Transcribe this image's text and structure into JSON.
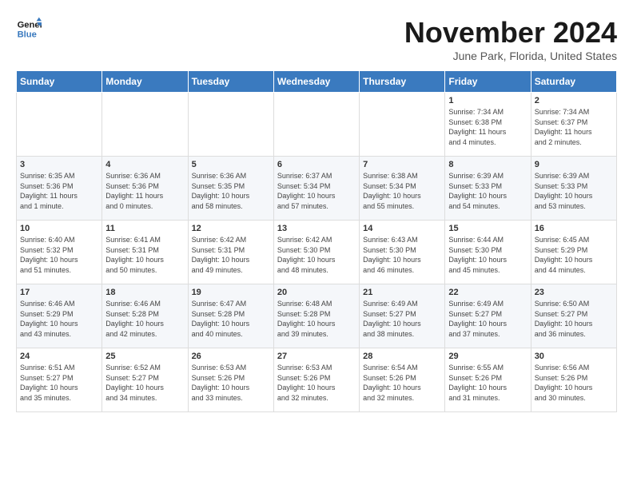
{
  "header": {
    "logo_line1": "General",
    "logo_line2": "Blue",
    "month": "November 2024",
    "location": "June Park, Florida, United States"
  },
  "weekdays": [
    "Sunday",
    "Monday",
    "Tuesday",
    "Wednesday",
    "Thursday",
    "Friday",
    "Saturday"
  ],
  "weeks": [
    [
      {
        "day": "",
        "info": ""
      },
      {
        "day": "",
        "info": ""
      },
      {
        "day": "",
        "info": ""
      },
      {
        "day": "",
        "info": ""
      },
      {
        "day": "",
        "info": ""
      },
      {
        "day": "1",
        "info": "Sunrise: 7:34 AM\nSunset: 6:38 PM\nDaylight: 11 hours\nand 4 minutes."
      },
      {
        "day": "2",
        "info": "Sunrise: 7:34 AM\nSunset: 6:37 PM\nDaylight: 11 hours\nand 2 minutes."
      }
    ],
    [
      {
        "day": "3",
        "info": "Sunrise: 6:35 AM\nSunset: 5:36 PM\nDaylight: 11 hours\nand 1 minute."
      },
      {
        "day": "4",
        "info": "Sunrise: 6:36 AM\nSunset: 5:36 PM\nDaylight: 11 hours\nand 0 minutes."
      },
      {
        "day": "5",
        "info": "Sunrise: 6:36 AM\nSunset: 5:35 PM\nDaylight: 10 hours\nand 58 minutes."
      },
      {
        "day": "6",
        "info": "Sunrise: 6:37 AM\nSunset: 5:34 PM\nDaylight: 10 hours\nand 57 minutes."
      },
      {
        "day": "7",
        "info": "Sunrise: 6:38 AM\nSunset: 5:34 PM\nDaylight: 10 hours\nand 55 minutes."
      },
      {
        "day": "8",
        "info": "Sunrise: 6:39 AM\nSunset: 5:33 PM\nDaylight: 10 hours\nand 54 minutes."
      },
      {
        "day": "9",
        "info": "Sunrise: 6:39 AM\nSunset: 5:33 PM\nDaylight: 10 hours\nand 53 minutes."
      }
    ],
    [
      {
        "day": "10",
        "info": "Sunrise: 6:40 AM\nSunset: 5:32 PM\nDaylight: 10 hours\nand 51 minutes."
      },
      {
        "day": "11",
        "info": "Sunrise: 6:41 AM\nSunset: 5:31 PM\nDaylight: 10 hours\nand 50 minutes."
      },
      {
        "day": "12",
        "info": "Sunrise: 6:42 AM\nSunset: 5:31 PM\nDaylight: 10 hours\nand 49 minutes."
      },
      {
        "day": "13",
        "info": "Sunrise: 6:42 AM\nSunset: 5:30 PM\nDaylight: 10 hours\nand 48 minutes."
      },
      {
        "day": "14",
        "info": "Sunrise: 6:43 AM\nSunset: 5:30 PM\nDaylight: 10 hours\nand 46 minutes."
      },
      {
        "day": "15",
        "info": "Sunrise: 6:44 AM\nSunset: 5:30 PM\nDaylight: 10 hours\nand 45 minutes."
      },
      {
        "day": "16",
        "info": "Sunrise: 6:45 AM\nSunset: 5:29 PM\nDaylight: 10 hours\nand 44 minutes."
      }
    ],
    [
      {
        "day": "17",
        "info": "Sunrise: 6:46 AM\nSunset: 5:29 PM\nDaylight: 10 hours\nand 43 minutes."
      },
      {
        "day": "18",
        "info": "Sunrise: 6:46 AM\nSunset: 5:28 PM\nDaylight: 10 hours\nand 42 minutes."
      },
      {
        "day": "19",
        "info": "Sunrise: 6:47 AM\nSunset: 5:28 PM\nDaylight: 10 hours\nand 40 minutes."
      },
      {
        "day": "20",
        "info": "Sunrise: 6:48 AM\nSunset: 5:28 PM\nDaylight: 10 hours\nand 39 minutes."
      },
      {
        "day": "21",
        "info": "Sunrise: 6:49 AM\nSunset: 5:27 PM\nDaylight: 10 hours\nand 38 minutes."
      },
      {
        "day": "22",
        "info": "Sunrise: 6:49 AM\nSunset: 5:27 PM\nDaylight: 10 hours\nand 37 minutes."
      },
      {
        "day": "23",
        "info": "Sunrise: 6:50 AM\nSunset: 5:27 PM\nDaylight: 10 hours\nand 36 minutes."
      }
    ],
    [
      {
        "day": "24",
        "info": "Sunrise: 6:51 AM\nSunset: 5:27 PM\nDaylight: 10 hours\nand 35 minutes."
      },
      {
        "day": "25",
        "info": "Sunrise: 6:52 AM\nSunset: 5:27 PM\nDaylight: 10 hours\nand 34 minutes."
      },
      {
        "day": "26",
        "info": "Sunrise: 6:53 AM\nSunset: 5:26 PM\nDaylight: 10 hours\nand 33 minutes."
      },
      {
        "day": "27",
        "info": "Sunrise: 6:53 AM\nSunset: 5:26 PM\nDaylight: 10 hours\nand 32 minutes."
      },
      {
        "day": "28",
        "info": "Sunrise: 6:54 AM\nSunset: 5:26 PM\nDaylight: 10 hours\nand 32 minutes."
      },
      {
        "day": "29",
        "info": "Sunrise: 6:55 AM\nSunset: 5:26 PM\nDaylight: 10 hours\nand 31 minutes."
      },
      {
        "day": "30",
        "info": "Sunrise: 6:56 AM\nSunset: 5:26 PM\nDaylight: 10 hours\nand 30 minutes."
      }
    ]
  ]
}
